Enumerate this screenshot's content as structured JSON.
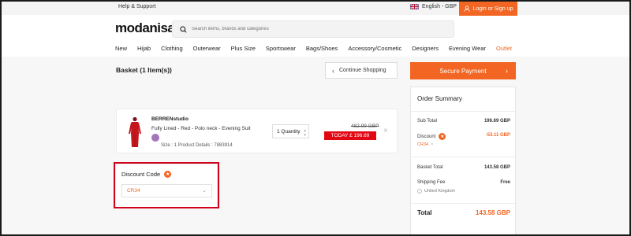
{
  "topbar": {
    "help": "Help & Support",
    "language": "English - GBP",
    "login": "Login or Sign up"
  },
  "header": {
    "logo": "modanisa",
    "search_placeholder": "Search items, brands and categories"
  },
  "nav": [
    "New",
    "Hijab",
    "Clothing",
    "Outerwear",
    "Plus Size",
    "Sportswear",
    "Bags/Shoes",
    "Accessory/Cosmetic",
    "Designers",
    "Evening Wear",
    "Outlet"
  ],
  "basket": {
    "title": "Basket (1 Item(s))",
    "continue_label": "Continue Shopping",
    "secure_label": "Secure Payment"
  },
  "item": {
    "brand": "BERRENstudio",
    "name": "Fully Lined - Red - Polo neck - Evening Suit",
    "size_text": "Size :  1    Product Details :  7883914",
    "quantity": "1 Quantity",
    "old_price": "482.99 GBP",
    "today_price": "TODAY £ 196.69"
  },
  "discount": {
    "title": "Discount Code",
    "code": "CR34"
  },
  "summary": {
    "title": "Order Summary",
    "subtotal_label": "Sub Total",
    "subtotal_value": "196.69 GBP",
    "discount_label": "Discount",
    "discount_value": "-53.11 GBP",
    "discount_code": "CR34",
    "basket_total_label": "Basket Total",
    "basket_total_value": "143.58 GBP",
    "shipping_label": "Shipping Fee",
    "shipping_value": "Free",
    "country": "United Kingdom",
    "total_label": "Total",
    "total_value": "143.58 GBP"
  },
  "colors": {
    "accent": "#f26522",
    "sale_red": "#e30613",
    "highlight_border": "#d0021b"
  }
}
